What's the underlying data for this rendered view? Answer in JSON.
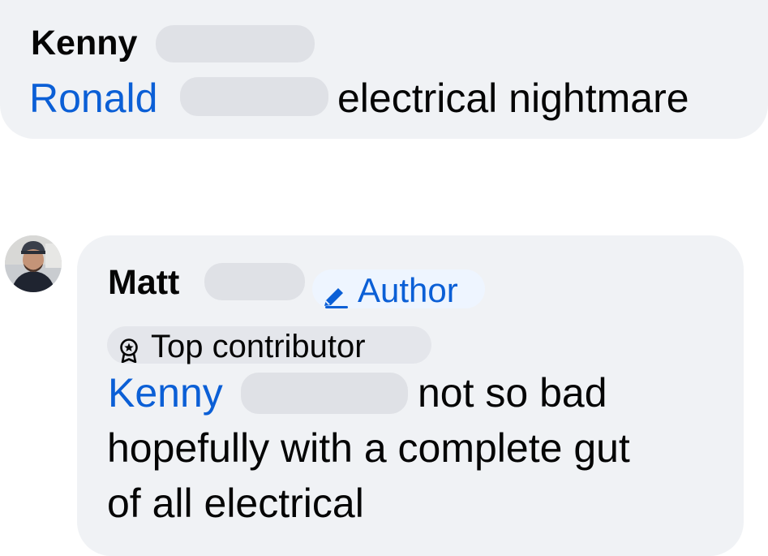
{
  "colors": {
    "bubble": "#f0f2f5",
    "mention": "#0b5fd6",
    "text": "#050505",
    "redaction": "#dfe1e6",
    "author_badge_bg": "#eef5ff",
    "contributor_badge_bg": "#e4e6eb"
  },
  "comment1": {
    "author": "Kenny",
    "mention": "Ronald",
    "text": "electrical nightmare"
  },
  "comment2": {
    "author": "Matt",
    "author_badge": "Author",
    "contributor_badge": "Top contributor",
    "mention": "Kenny",
    "line1": "not so bad",
    "line2": "hopefully with a complete gut",
    "line3": "of all electrical"
  },
  "icons": {
    "author_badge_icon": "pencil-icon",
    "contributor_badge_icon": "medal-icon",
    "avatar": "user-avatar"
  }
}
